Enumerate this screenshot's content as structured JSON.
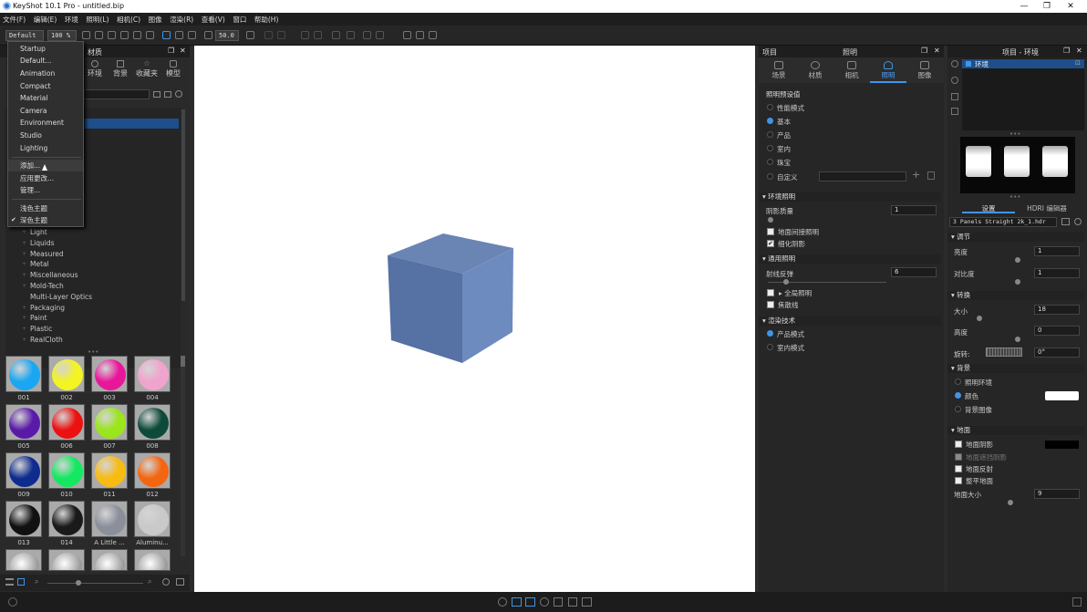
{
  "window": {
    "title": "KeyShot 10.1 Pro  -  untitled.bip",
    "minimize": "—",
    "restore": "❐",
    "close": "✕"
  },
  "menubar": [
    "文件(F)",
    "编辑(E)",
    "环境",
    "照明(L)",
    "相机(C)",
    "图像",
    "渲染(R)",
    "查看(V)",
    "窗口",
    "帮助(H)"
  ],
  "toolbar": {
    "workspace": "Default",
    "zoom": "100 %",
    "fov": "50.0"
  },
  "dropdown": {
    "items": [
      "Startup",
      "Default...",
      "Animation",
      "Compact",
      "Material",
      "Camera",
      "Environment",
      "Studio",
      "Lighting"
    ],
    "actions": [
      "添加...",
      "应用更改...",
      "管理..."
    ],
    "themes": [
      "浅色主题",
      "深色主题"
    ],
    "checked_theme": "深色主题"
  },
  "library": {
    "title": "材质",
    "tabs": [
      "环境",
      "背景",
      "收藏夹",
      "模型"
    ],
    "categories": [
      "Light",
      "Liquids",
      "Measured",
      "Metal",
      "Miscellaneous",
      "Mold-Tech",
      "Multi-Layer Optics",
      "Packaging",
      "Paint",
      "Plastic",
      "RealCloth"
    ],
    "materials": [
      {
        "label": "001",
        "color": "#1aa6f2"
      },
      {
        "label": "002",
        "color": "#f4f422"
      },
      {
        "label": "003",
        "color": "#e8179a"
      },
      {
        "label": "004",
        "color": "#f0a3cd"
      },
      {
        "label": "005",
        "color": "#5a1aa8"
      },
      {
        "label": "006",
        "color": "#ec1111"
      },
      {
        "label": "007",
        "color": "#9ae51c"
      },
      {
        "label": "008",
        "color": "#0e4a3a"
      },
      {
        "label": "009",
        "color": "#0e2b8e"
      },
      {
        "label": "010",
        "color": "#13e860"
      },
      {
        "label": "011",
        "color": "#f8bb12"
      },
      {
        "label": "012",
        "color": "#f4650f"
      },
      {
        "label": "013",
        "color": "#111111"
      },
      {
        "label": "014",
        "color": "#1a1a1a"
      },
      {
        "label": "A Little ...",
        "color": "#8a8f9a"
      },
      {
        "label": "Aluminu...",
        "color": "#c9c9c9"
      }
    ]
  },
  "lighting": {
    "panel_title": "项目",
    "panel_subtitle": "照明",
    "tabs": [
      "场景",
      "材质",
      "相机",
      "照明",
      "图像"
    ],
    "presets_header": "照明预设值",
    "presets": [
      "性能模式",
      "基本",
      "产品",
      "室内",
      "珠宝",
      "自定义"
    ],
    "selected_preset": "基本",
    "env_header": "环境照明",
    "shadow_quality_label": "阴影质量",
    "shadow_quality": "1",
    "ground_indirect": "地面间接照明",
    "flatten_shadows": "细化阴影",
    "general_header": "通用照明",
    "ray_bounces_label": "射线反弹",
    "ray_bounces": "6",
    "global_illumination": "全局照明",
    "caustics": "焦散线",
    "render_tech_header": "渲染技术",
    "render_modes": [
      "产品模式",
      "室内模式"
    ]
  },
  "environment": {
    "panel_title": "项目 - 环境",
    "tree_item": "环境",
    "tabs": [
      "设置",
      "HDRI 编辑器"
    ],
    "hdri_file": "3 Panels Straight 2k_1.hdr",
    "adjust_header": "调节",
    "brightness_label": "亮度",
    "brightness": "1",
    "contrast_label": "对比度",
    "contrast": "1",
    "transform_header": "转换",
    "size_label": "大小",
    "size": "18",
    "height_label": "高度",
    "height": "0",
    "rotation_label": "旋转:",
    "rotation": "0°",
    "bg_header": "背景",
    "bg_options": [
      "照明环境",
      "颜色",
      "背景图像"
    ],
    "bg_selected": "颜色",
    "bg_color": "#ffffff",
    "ground_header": "地面",
    "ground_options": [
      "地面阴影",
      "地面遮挡阴影",
      "地面反射",
      "整平地面"
    ],
    "ground_shadow_color": "#000000",
    "ground_size_label": "地面大小",
    "ground_size": "9"
  }
}
